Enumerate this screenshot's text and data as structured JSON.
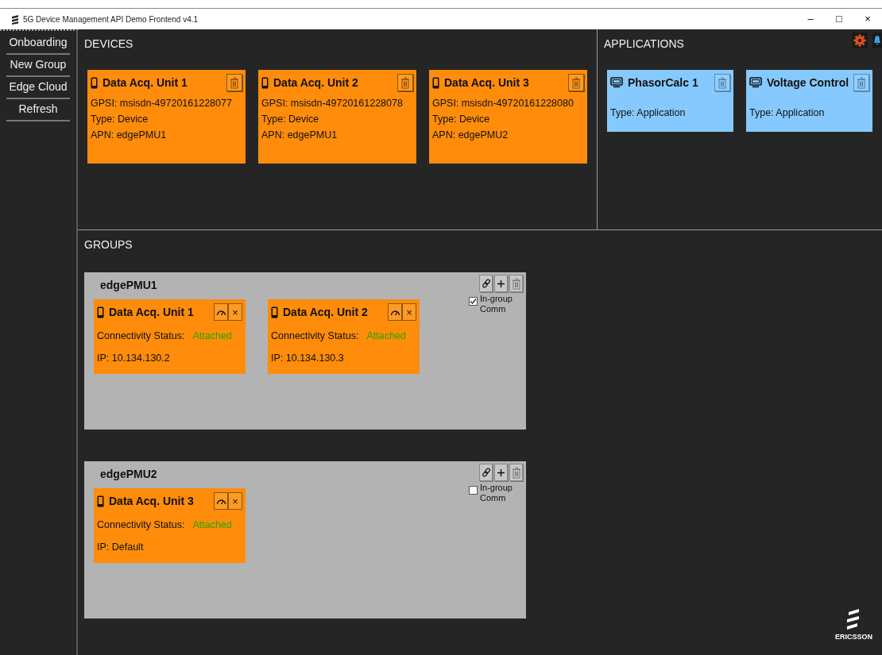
{
  "window": {
    "title": "5G Device Management API Demo Frontend v4.1",
    "controls": [
      "–",
      "□",
      "×"
    ]
  },
  "sidebar": {
    "items": [
      "Onboarding",
      "New Group",
      "Edge Cloud",
      "Refresh"
    ]
  },
  "devices": {
    "heading": "DEVICES",
    "cards": [
      {
        "name": "Data Acq. Unit 1",
        "gpsi": "GPSI: msisdn-49720161228077",
        "type": "Type: Device",
        "apn": "APN: edgePMU1"
      },
      {
        "name": "Data Acq. Unit 2",
        "gpsi": "GPSI: msisdn-49720161228078",
        "type": "Type: Device",
        "apn": "APN: edgePMU1"
      },
      {
        "name": "Data Acq. Unit 3",
        "gpsi": "GPSI: msisdn-49720161228080",
        "type": "Type: Device",
        "apn": "APN: edgePMU2"
      }
    ]
  },
  "applications": {
    "heading": "APPLICATIONS",
    "cards": [
      {
        "name": "PhasorCalc 1",
        "type": "Type: Application"
      },
      {
        "name": "Voltage Control",
        "type": "Type: Application"
      }
    ]
  },
  "groups": {
    "heading": "GROUPS",
    "items": [
      {
        "name": "edgePMU1",
        "in_group_comm": {
          "label": "In-group Comm",
          "checked": true
        },
        "members": [
          {
            "name": "Data Acq. Unit 1",
            "close": "×",
            "status_label": "Connectivity Status:",
            "status": "Attached",
            "color": "#22aa00",
            "ip": "IP: 10.134.130.2"
          },
          {
            "name": "Data Acq. Unit 2",
            "close": "×",
            "status_label": "Connectivity Status:",
            "status": "Attached",
            "color": "#22aa00",
            "ip": "IP: 10.134.130.3"
          }
        ]
      },
      {
        "name": "edgePMU2",
        "in_group_comm": {
          "label": "In-group Comm",
          "checked": false
        },
        "members": [
          {
            "name": "Data Acq. Unit 3",
            "close": "×",
            "status_label": "Connectivity Status:",
            "status": "Attached",
            "color": "#22aa00",
            "ip": "IP: Default"
          }
        ]
      }
    ]
  },
  "logo": {
    "text": "ERICSSON"
  }
}
